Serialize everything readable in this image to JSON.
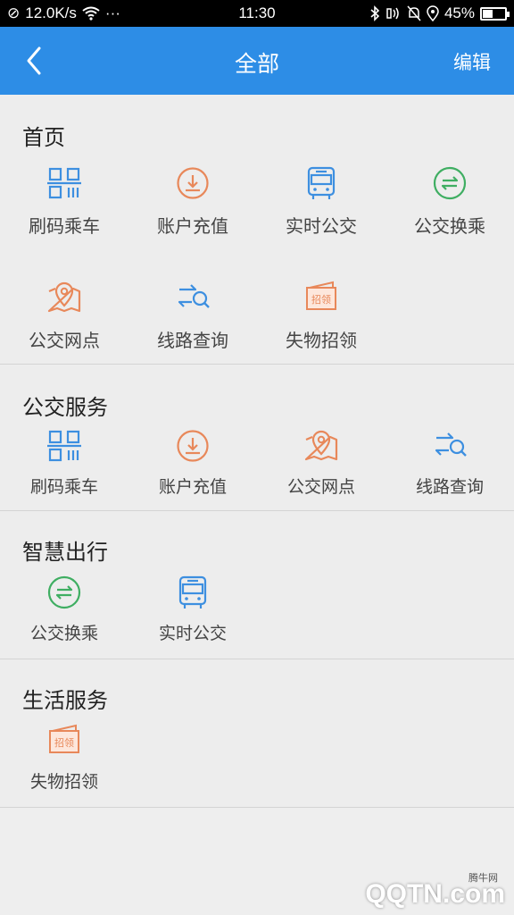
{
  "status_bar": {
    "speed": "12.0K/s",
    "dots": "···",
    "time": "11:30",
    "battery": "45%",
    "battery_level": 0.45
  },
  "app_bar": {
    "title": "全部",
    "edit_label": "编辑"
  },
  "colors": {
    "primary": "#2d8de6",
    "icon_blue": "#3d8fe0",
    "icon_orange": "#e8885a",
    "icon_green": "#3fae62",
    "background": "#eeeeee"
  },
  "sections": [
    {
      "title": "首页",
      "items": [
        {
          "label": "刷码乘车",
          "icon": "qr-code-icon"
        },
        {
          "label": "账户充值",
          "icon": "download-circle-icon"
        },
        {
          "label": "实时公交",
          "icon": "bus-icon"
        },
        {
          "label": "公交换乘",
          "icon": "transfer-circle-icon"
        },
        {
          "label": "公交网点",
          "icon": "map-pin-icon"
        },
        {
          "label": "线路查询",
          "icon": "route-search-icon"
        },
        {
          "label": "失物招领",
          "icon": "lost-found-icon",
          "icon_text": "招领"
        }
      ]
    },
    {
      "title": "公交服务",
      "items": [
        {
          "label": "刷码乘车",
          "icon": "qr-code-icon"
        },
        {
          "label": "账户充值",
          "icon": "download-circle-icon"
        },
        {
          "label": "公交网点",
          "icon": "map-pin-icon"
        },
        {
          "label": "线路查询",
          "icon": "route-search-icon"
        }
      ]
    },
    {
      "title": "智慧出行",
      "items": [
        {
          "label": "公交换乘",
          "icon": "transfer-circle-icon"
        },
        {
          "label": "实时公交",
          "icon": "bus-icon"
        }
      ]
    },
    {
      "title": "生活服务",
      "items": [
        {
          "label": "失物招领",
          "icon": "lost-found-icon",
          "icon_text": "招领"
        }
      ]
    }
  ],
  "watermark": {
    "text": "QQTN.com",
    "small": "腾牛网"
  }
}
